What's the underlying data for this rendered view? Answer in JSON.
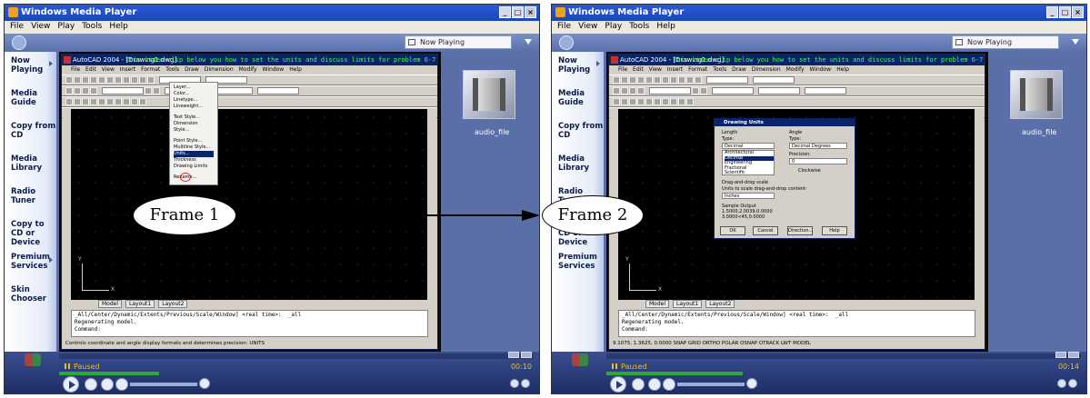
{
  "window": {
    "title": "Windows Media Player",
    "min": "_",
    "max": "□",
    "close": "×"
  },
  "menubar": [
    "File",
    "View",
    "Play",
    "Tools",
    "Help"
  ],
  "now_playing_dropdown": "Now Playing",
  "sidebar": [
    {
      "label": "Now Playing"
    },
    {
      "label": "Media Guide"
    },
    {
      "label": "Copy from CD"
    },
    {
      "label": "Media Library"
    },
    {
      "label": "Radio Tuner"
    },
    {
      "label": "Copy to CD or Device"
    },
    {
      "label": "Premium Services"
    },
    {
      "label": "Skin Chooser"
    }
  ],
  "audio_file_label": "audio_file",
  "playback": {
    "status": "Paused",
    "time_frame1": "00:10",
    "time_frame2": "00:14"
  },
  "autocad": {
    "title": "AutoCAD 2004 - [Drawing1.dwg]",
    "overlay_note": "This video clip below you how to set the units and discuss limits for problem 6-7",
    "menu": [
      "File",
      "Edit",
      "View",
      "Insert",
      "Format",
      "Tools",
      "Draw",
      "Dimension",
      "Modify",
      "Window",
      "Help"
    ],
    "tabs": [
      "Model",
      "Layout1",
      "Layout2"
    ],
    "command_lines": [
      "_All/Center/Dynamic/Extents/Previous/Scale/Window] <real time>:  _all",
      "Regenerating model.",
      "Command:"
    ],
    "status_text_f1": "Controls coordinate and angle display formats and determines precision:  UNITS",
    "status_text_f2": "9.1075, 1.3625, 0.0000    SNAP GRID ORTHO POLAR OSNAP OTRACK LWT MODEL",
    "format_menu": [
      "Layer...",
      "Color...",
      "Linetype...",
      "Lineweight...",
      "Text Style...",
      "Dimension Style...",
      "Point Style...",
      "Multiline Style...",
      "Units...",
      "Thickness",
      "Drawing Limits",
      "Rename..."
    ],
    "format_menu_selected": "Units..."
  },
  "units_dialog": {
    "title": "Drawing Units",
    "length_label": "Length",
    "type_label": "Type:",
    "length_type": "Decimal",
    "length_options": [
      "Architectural",
      "Decimal",
      "Engineering",
      "Fractional",
      "Scientific"
    ],
    "angle_label": "Angle",
    "angle_type": "Decimal Degrees",
    "precision_label": "Precision:",
    "precision": "0",
    "clockwise": "Clockwise",
    "dragdrop_label": "Drag-and-drop scale",
    "dragdrop_desc": "Units to scale drag-and-drop content:",
    "dragdrop_value": "Inches",
    "sample_label": "Sample Output",
    "sample_values": [
      "1.5000,2.0039,0.0000",
      "3.0000<45,0.0000"
    ],
    "buttons": [
      "OK",
      "Cancel",
      "Direction...",
      "Help"
    ]
  },
  "callouts": {
    "frame1": "Frame 1",
    "frame2": "Frame 2"
  }
}
